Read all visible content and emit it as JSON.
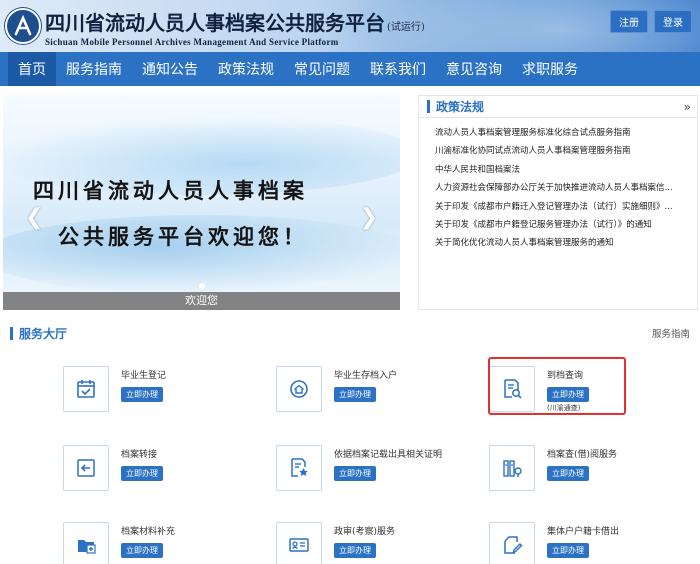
{
  "header": {
    "title_cn": "四川省流动人员人事档案公共服务平台",
    "title_suffix": "(试运行)",
    "title_en": "Sichuan Mobile Personnel Archives Management And Service Platform",
    "register_label": "注册",
    "login_label": "登录"
  },
  "nav": {
    "items": [
      {
        "label": "首页",
        "active": true
      },
      {
        "label": "服务指南"
      },
      {
        "label": "通知公告"
      },
      {
        "label": "政策法规"
      },
      {
        "label": "常见问题"
      },
      {
        "label": "联系我们"
      },
      {
        "label": "意见咨询"
      },
      {
        "label": "求职服务"
      }
    ]
  },
  "banner": {
    "line1": "四川省流动人员人事档案",
    "line2": "公共服务平台欢迎您！",
    "caption": "欢迎您",
    "prev_icon": "chevron-left-icon",
    "next_icon": "chevron-right-icon"
  },
  "policy": {
    "title": "政策法规",
    "more_icon": "double-chevron-right-icon",
    "items": [
      "流动人员人事档案管理服务标准化综合试点服务指南",
      "川渝标准化协同试点流动人员人事档案管理服务指南",
      "中华人民共和国档案法",
      "人力资源社会保障部办公厅关于加快推进流动人员人事档案信...",
      "关于印发《成都市户籍迁入登记管理办法（试行）实施细则》...",
      "关于印发《成都市户籍登记服务管理办法（试行）》的通知",
      "关于简化优化流动人员人事档案管理服务的通知"
    ]
  },
  "service": {
    "title": "服务大厅",
    "guide_label": "服务指南",
    "button_label": "立即办理",
    "items": [
      {
        "name": "毕业生登记",
        "icon": "calendar-check-icon"
      },
      {
        "name": "毕业生存档入户",
        "icon": "home-badge-icon"
      },
      {
        "name": "到档查询",
        "icon": "document-search-icon",
        "sub": "(川渝通查)"
      },
      {
        "name": "档案转接",
        "icon": "transfer-arrow-icon"
      },
      {
        "name": "依据档案记载出具相关证明",
        "icon": "certificate-icon"
      },
      {
        "name": "档案查(借)阅服务",
        "icon": "archive-files-icon"
      },
      {
        "name": "档案材料补充",
        "icon": "folder-add-icon"
      },
      {
        "name": "政审(考察)服务",
        "icon": "id-card-icon"
      },
      {
        "name": "集体户户籍卡借出",
        "icon": "edit-card-icon"
      }
    ]
  },
  "colors": {
    "primary": "#2b72c5",
    "highlight": "#e03030"
  }
}
